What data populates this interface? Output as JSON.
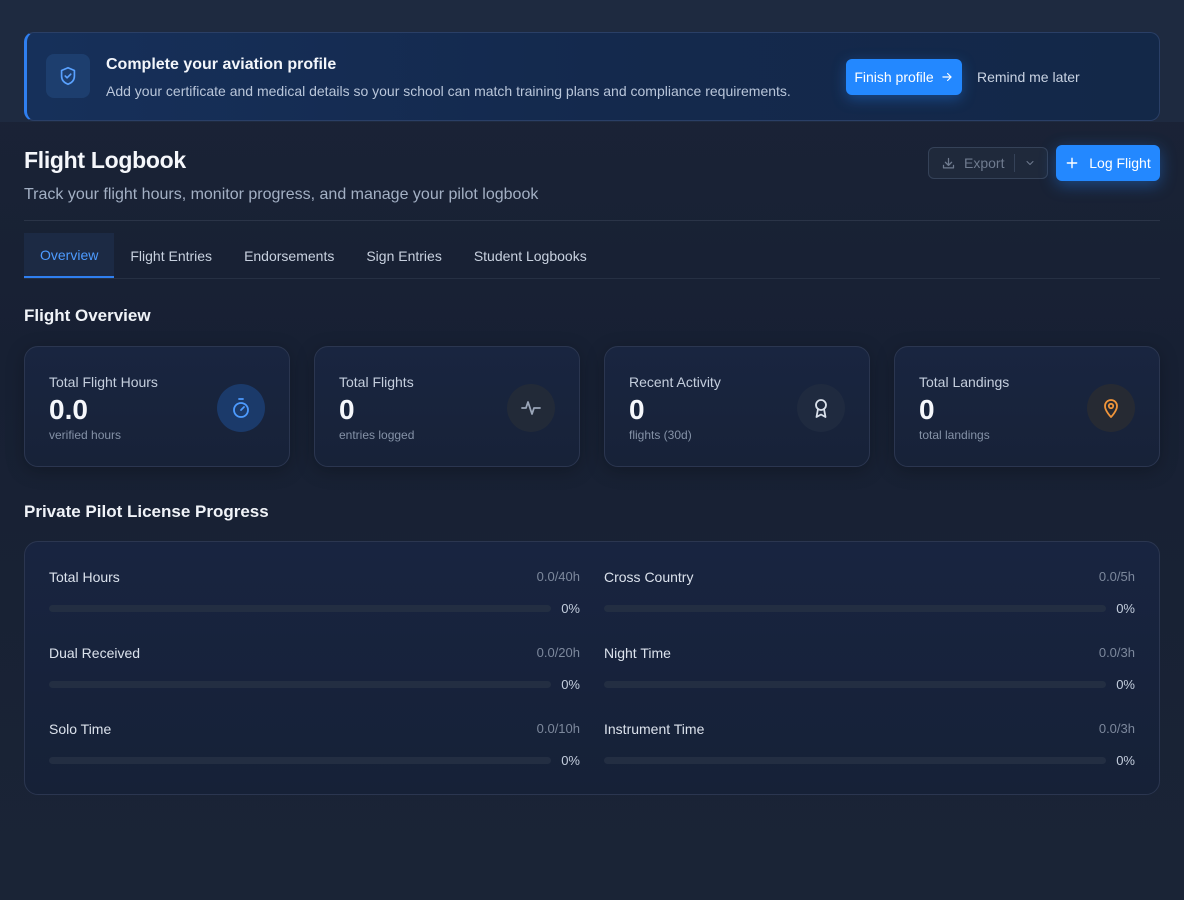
{
  "banner": {
    "title": "Complete your aviation profile",
    "description": "Add your certificate and medical details so your school can match training plans and compliance requirements.",
    "finish_label": "Finish profile",
    "remind_label": "Remind me later",
    "icon": "shield-check-icon"
  },
  "header": {
    "title": "Flight Logbook",
    "subtitle": "Track your flight hours, monitor progress, and manage your pilot logbook",
    "export_label": "Export",
    "log_flight_label": "Log Flight"
  },
  "tabs": [
    {
      "label": "Overview",
      "active": true
    },
    {
      "label": "Flight Entries",
      "active": false
    },
    {
      "label": "Endorsements",
      "active": false
    },
    {
      "label": "Sign Entries",
      "active": false
    },
    {
      "label": "Student Logbooks",
      "active": false
    }
  ],
  "overview": {
    "title": "Flight Overview",
    "cards": [
      {
        "label": "Total Flight Hours",
        "value": "0.0",
        "sub": "verified hours",
        "icon": "stopwatch-icon",
        "icon_color": "#4d9bff"
      },
      {
        "label": "Total Flights",
        "value": "0",
        "sub": "entries logged",
        "icon": "activity-pulse-icon",
        "icon_color": "#9aa5b8"
      },
      {
        "label": "Recent Activity",
        "value": "0",
        "sub": "flights (30d)",
        "icon": "award-ribbon-icon",
        "icon_color": "#d9e0ea"
      },
      {
        "label": "Total Landings",
        "value": "0",
        "sub": "total landings",
        "icon": "map-pin-icon",
        "icon_color": "#f0953a"
      }
    ]
  },
  "progress": {
    "title": "Private Pilot License Progress",
    "items": [
      {
        "label": "Total Hours",
        "ratio": "0.0/40h",
        "percent": "0%",
        "fraction": 0
      },
      {
        "label": "Cross Country",
        "ratio": "0.0/5h",
        "percent": "0%",
        "fraction": 0
      },
      {
        "label": "Dual Received",
        "ratio": "0.0/20h",
        "percent": "0%",
        "fraction": 0
      },
      {
        "label": "Night Time",
        "ratio": "0.0/3h",
        "percent": "0%",
        "fraction": 0
      },
      {
        "label": "Solo Time",
        "ratio": "0.0/10h",
        "percent": "0%",
        "fraction": 0
      },
      {
        "label": "Instrument Time",
        "ratio": "0.0/3h",
        "percent": "0%",
        "fraction": 0
      }
    ]
  },
  "colors": {
    "accent": "#2388ff",
    "background": "#1a2234"
  }
}
